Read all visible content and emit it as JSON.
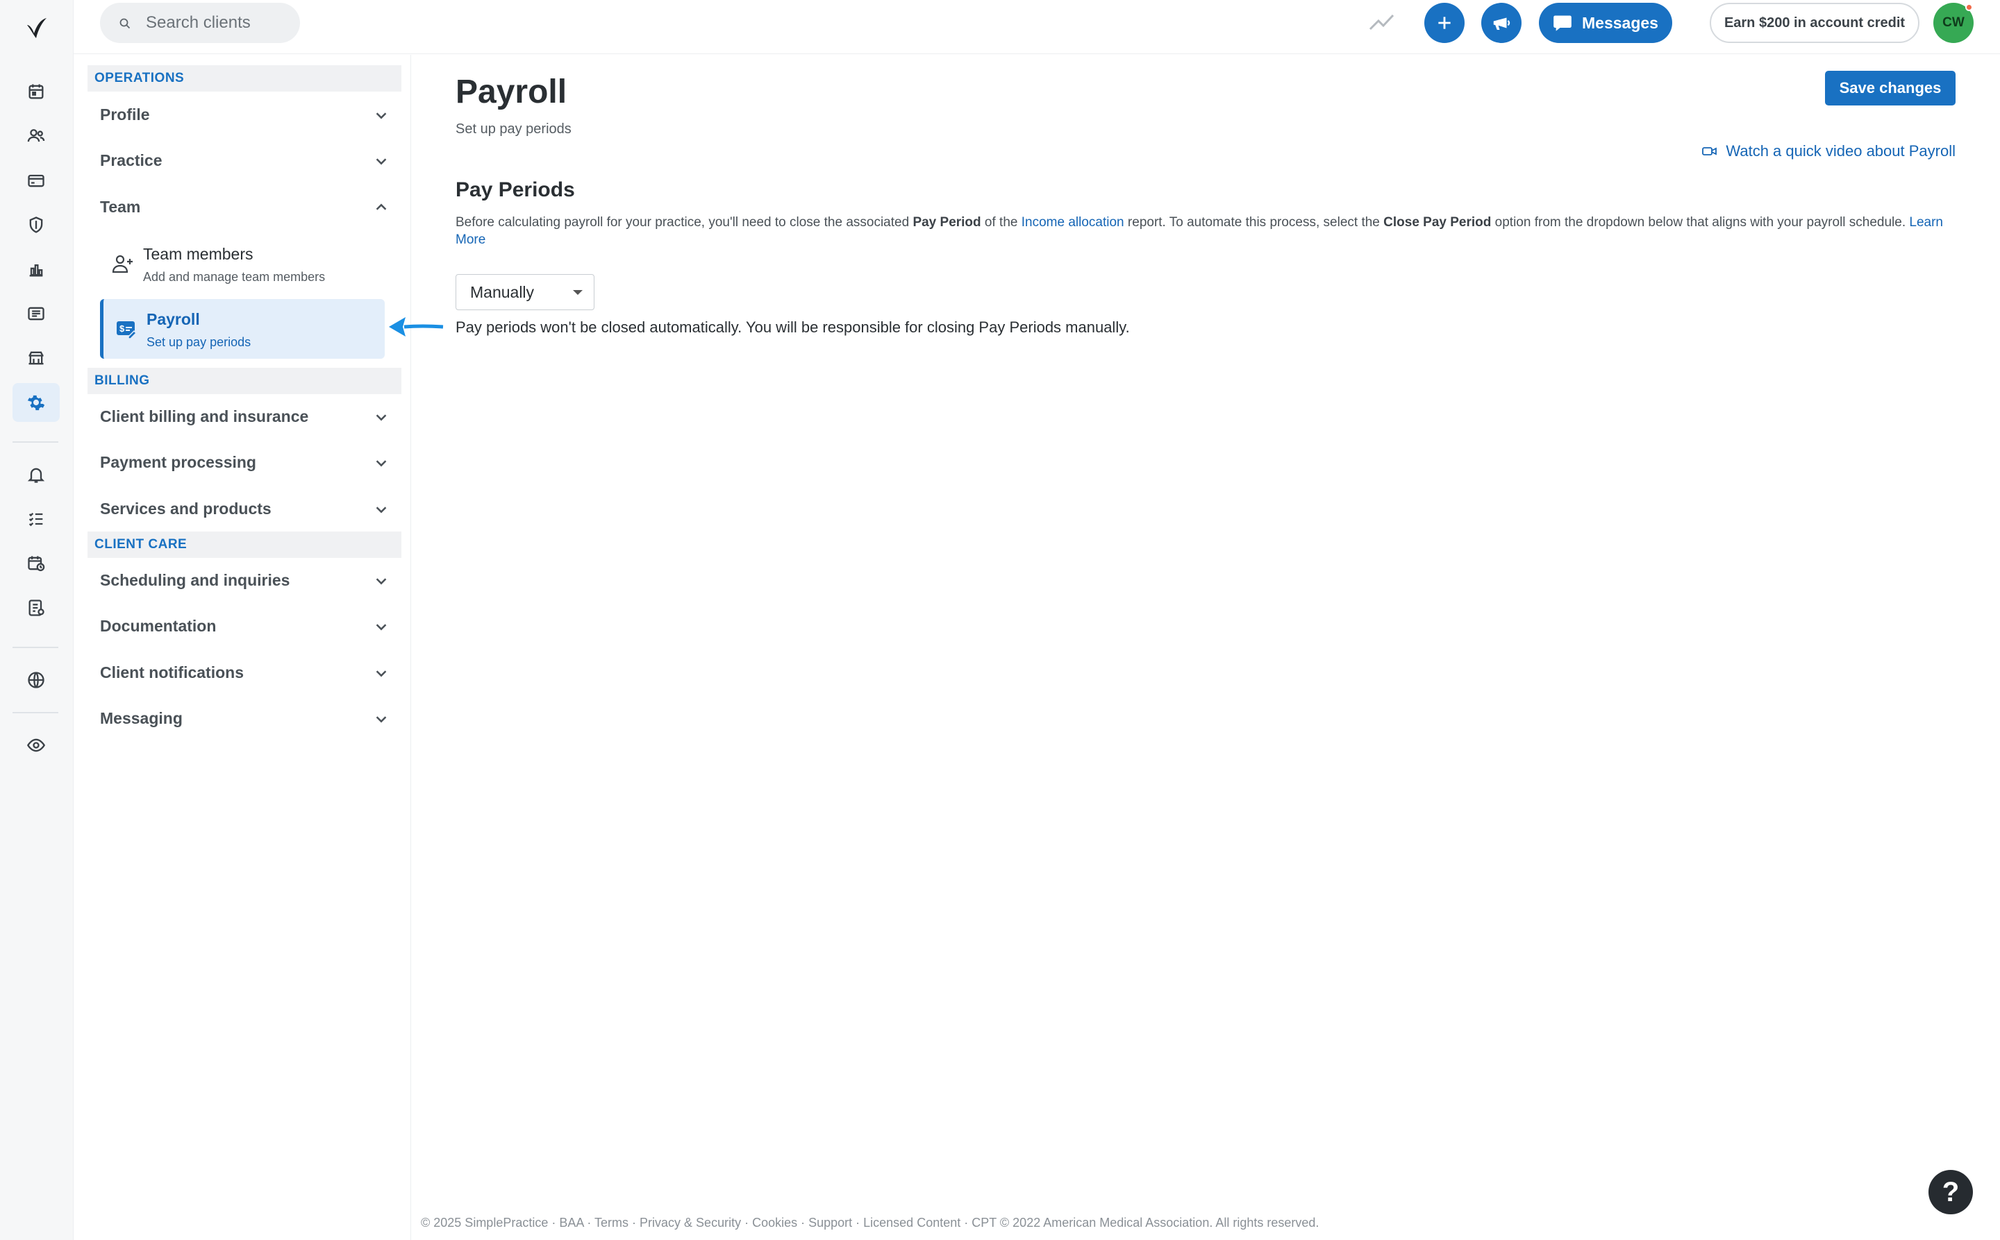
{
  "search": {
    "placeholder": "Search clients"
  },
  "header": {
    "messages_label": "Messages",
    "earn_label": "Earn $200 in account credit",
    "avatar_initials": "CW"
  },
  "sidebar": {
    "sections": {
      "operations": "OPERATIONS",
      "billing": "BILLING",
      "client_care": "CLIENT CARE"
    },
    "items": {
      "profile": "Profile",
      "practice": "Practice",
      "team": "Team",
      "client_billing": "Client billing and insurance",
      "payment_processing": "Payment processing",
      "services_products": "Services and products",
      "scheduling": "Scheduling and inquiries",
      "documentation": "Documentation",
      "client_notifications": "Client notifications",
      "messaging": "Messaging"
    },
    "team_sub": {
      "members_title": "Team members",
      "members_desc": "Add and manage team members",
      "payroll_title": "Payroll",
      "payroll_desc": "Set up pay periods"
    }
  },
  "main": {
    "title": "Payroll",
    "subtitle": "Set up pay periods",
    "save_label": "Save changes",
    "video_link": "Watch a quick video about Payroll",
    "section_title": "Pay Periods",
    "desc": {
      "part1": "Before calculating payroll for your practice, you'll need to close the associated ",
      "bold1": "Pay Period",
      "part2": " of the ",
      "link1": "Income allocation",
      "part3": " report. To automate this process, select the ",
      "bold2": "Close Pay Period",
      "part4": " option from the dropdown below that aligns with your payroll schedule. ",
      "link2": "Learn More"
    },
    "select_value": "Manually",
    "hint": "Pay periods won't be closed automatically. You will be responsible for closing Pay Periods manually."
  },
  "footer": "© 2025 SimplePractice · BAA · Terms · Privacy & Security · Cookies · Support · Licensed Content · CPT © 2022 American Medical Association. All rights reserved.",
  "help_label": "?",
  "colors": {
    "accent": "#1971c2",
    "avatar": "#36a954"
  }
}
